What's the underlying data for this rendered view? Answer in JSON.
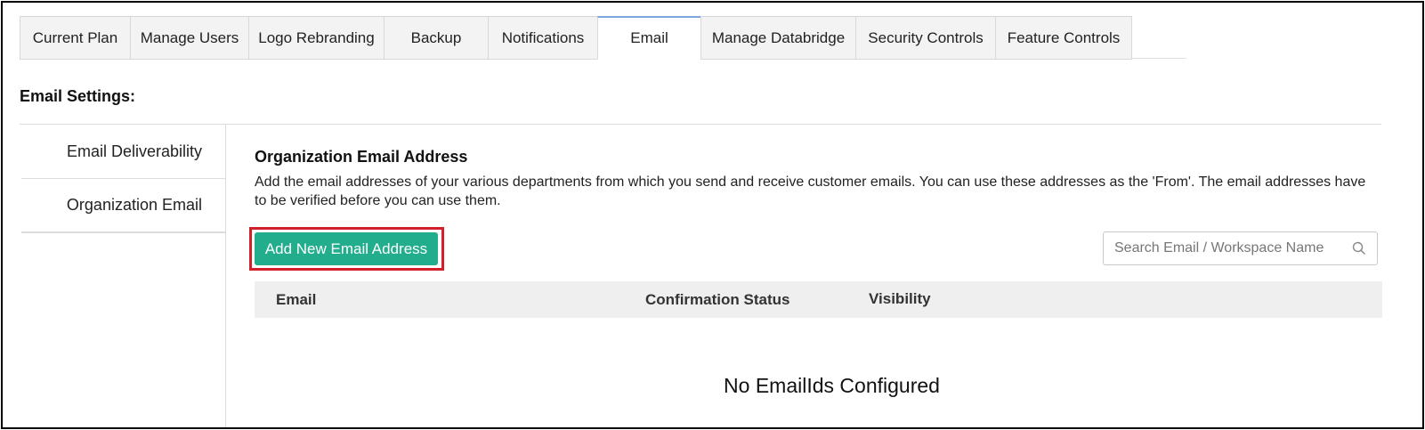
{
  "tabs": [
    {
      "label": "Current Plan",
      "active": false
    },
    {
      "label": "Manage Users",
      "active": false
    },
    {
      "label": "Logo Rebranding",
      "active": false
    },
    {
      "label": "Backup",
      "active": false
    },
    {
      "label": "Notifications",
      "active": false
    },
    {
      "label": "Email",
      "active": true
    },
    {
      "label": "Manage Databridge",
      "active": false
    },
    {
      "label": "Security Controls",
      "active": false
    },
    {
      "label": "Feature Controls",
      "active": false
    }
  ],
  "settings_title": "Email Settings:",
  "subnav": [
    {
      "label": "Email Deliverability",
      "active": false
    },
    {
      "label": "Organization Email",
      "active": true
    }
  ],
  "main": {
    "title": "Organization Email Address",
    "description": "Add the email addresses of your various departments from which you send and receive customer emails. You can use these addresses as the 'From'. The email addresses have to be verified before you can use them.",
    "add_button": "Add New Email Address",
    "search_placeholder": "Search Email / Workspace Name",
    "columns": {
      "email": "Email",
      "confirmation": "Confirmation Status",
      "visibility": "Visibility"
    },
    "empty_text": "No EmailIds Configured"
  },
  "colors": {
    "accent_button": "#22ad8c",
    "highlight": "#d21f2a",
    "active_tab_top": "#7aa7e0"
  }
}
